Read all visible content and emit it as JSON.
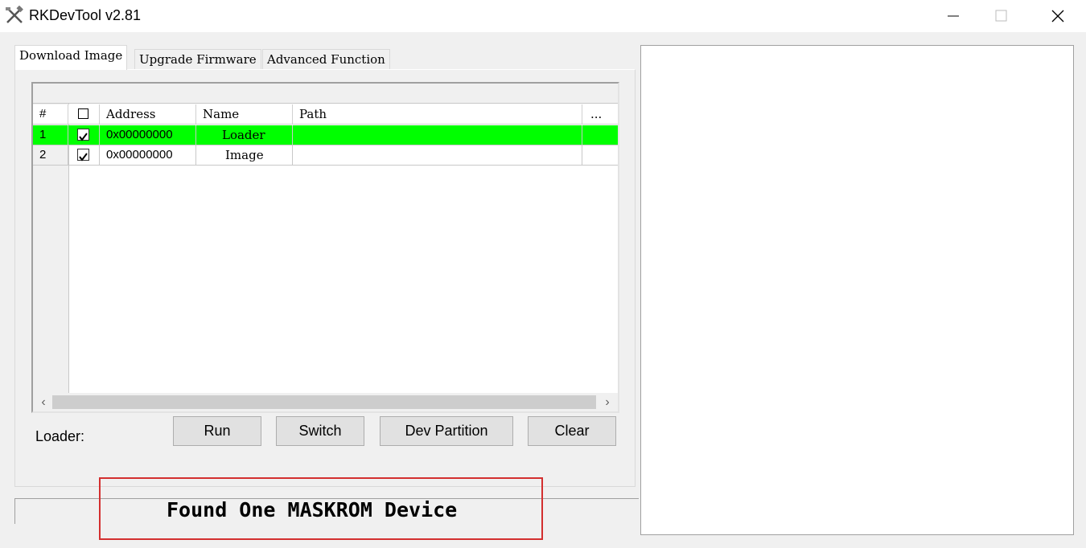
{
  "window": {
    "title": "RKDevTool v2.81",
    "icon": "tools-icon"
  },
  "tabs": [
    {
      "label": "Download Image",
      "active": true
    },
    {
      "label": "Upgrade Firmware",
      "active": false
    },
    {
      "label": "Advanced Function",
      "active": false
    }
  ],
  "table": {
    "headers": {
      "num": "#",
      "address": "Address",
      "name": "Name",
      "path": "Path",
      "more": "..."
    },
    "rows": [
      {
        "num": "1",
        "checked": true,
        "address": "0x00000000",
        "name": "Loader",
        "path": "",
        "selected": true
      },
      {
        "num": "2",
        "checked": true,
        "address": "0x00000000",
        "name": "Image",
        "path": "",
        "selected": false
      }
    ],
    "selected_color": "#00ff00"
  },
  "loader_label": "Loader:",
  "buttons": {
    "run": "Run",
    "switch": "Switch",
    "dev_partition": "Dev Partition",
    "clear": "Clear"
  },
  "status": {
    "text": "Found One MASKROM Device",
    "highlight_color": "#d32f2f"
  }
}
